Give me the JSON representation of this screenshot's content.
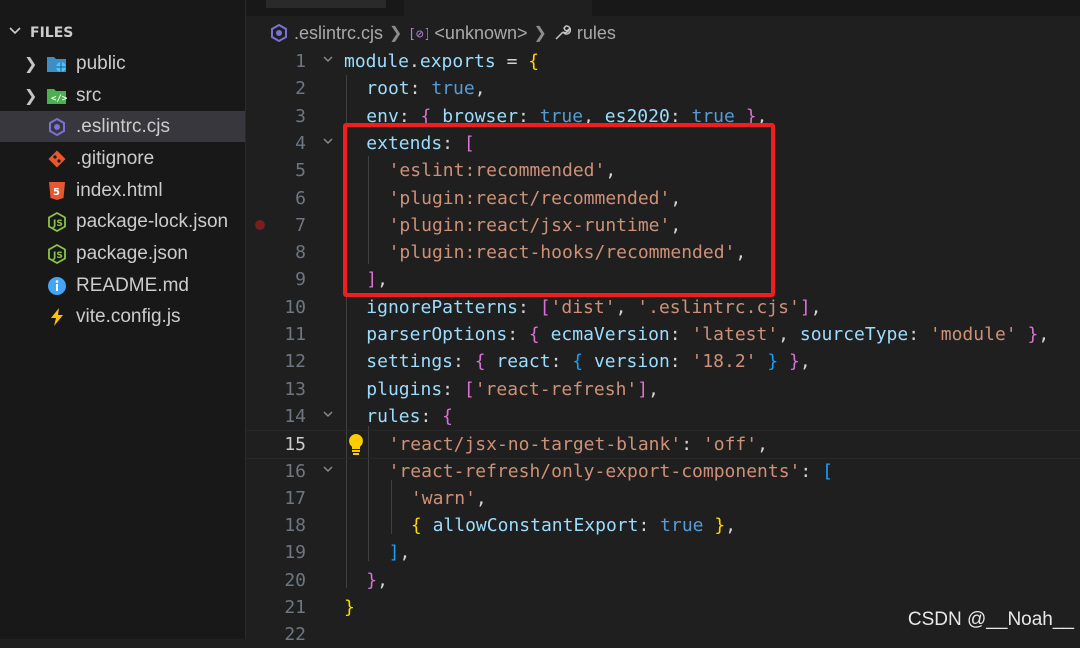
{
  "sidebar": {
    "header": "FILES",
    "items": [
      {
        "label": "public",
        "type": "folder",
        "icon": "folder-public-icon",
        "color": "#4fc1ff"
      },
      {
        "label": "src",
        "type": "folder",
        "icon": "folder-src-icon",
        "color": "#4caf50"
      },
      {
        "label": ".eslintrc.cjs",
        "type": "file",
        "icon": "eslint-icon",
        "color": "#7c6fd6",
        "selected": true
      },
      {
        "label": ".gitignore",
        "type": "file",
        "icon": "git-icon",
        "color": "#e8572f"
      },
      {
        "label": "index.html",
        "type": "file",
        "icon": "html-icon",
        "color": "#e8572f"
      },
      {
        "label": "package-lock.json",
        "type": "file",
        "icon": "nodejs-icon",
        "color": "#8bc34a"
      },
      {
        "label": "package.json",
        "type": "file",
        "icon": "nodejs-icon",
        "color": "#8bc34a"
      },
      {
        "label": "README.md",
        "type": "file",
        "icon": "info-icon",
        "color": "#42a5f5"
      },
      {
        "label": "vite.config.js",
        "type": "file",
        "icon": "vite-icon",
        "color": "#ffc107"
      }
    ]
  },
  "breadcrumb": {
    "file": ".eslintrc.cjs",
    "symbol1": "<unknown>",
    "symbol2": "rules"
  },
  "editor": {
    "active_line": 15,
    "lines": [
      {
        "n": "1",
        "fold": true,
        "tokens": [
          [
            "k",
            "module"
          ],
          [
            "p",
            "."
          ],
          [
            "k",
            "exports"
          ],
          [
            "p",
            " = "
          ],
          [
            "b1",
            "{"
          ]
        ]
      },
      {
        "n": "2",
        "tokens": [
          [
            "k",
            "root"
          ],
          [
            "p",
            ": "
          ],
          [
            "v",
            "true"
          ],
          [
            "p",
            ","
          ]
        ]
      },
      {
        "n": "3",
        "tokens": [
          [
            "k",
            "env"
          ],
          [
            "p",
            ": "
          ],
          [
            "b2",
            "{"
          ],
          [
            "p",
            " "
          ],
          [
            "k",
            "browser"
          ],
          [
            "p",
            ": "
          ],
          [
            "v",
            "true"
          ],
          [
            "p",
            ", "
          ],
          [
            "k",
            "es2020"
          ],
          [
            "p",
            ": "
          ],
          [
            "v",
            "true"
          ],
          [
            "p",
            " "
          ],
          [
            "b2",
            "}"
          ],
          [
            "p",
            ","
          ]
        ]
      },
      {
        "n": "4",
        "fold": true,
        "tokens": [
          [
            "k",
            "extends"
          ],
          [
            "p",
            ": "
          ],
          [
            "b2",
            "["
          ]
        ]
      },
      {
        "n": "5",
        "tokens": [
          [
            "s",
            "'eslint:recommended'"
          ],
          [
            "p",
            ","
          ]
        ]
      },
      {
        "n": "6",
        "tokens": [
          [
            "s",
            "'plugin:react/recommended'"
          ],
          [
            "p",
            ","
          ]
        ]
      },
      {
        "n": "7",
        "tokens": [
          [
            "s",
            "'plugin:react/jsx-runtime'"
          ],
          [
            "p",
            ","
          ]
        ]
      },
      {
        "n": "8",
        "tokens": [
          [
            "s",
            "'plugin:react-hooks/recommended'"
          ],
          [
            "p",
            ","
          ]
        ]
      },
      {
        "n": "9",
        "tokens": [
          [
            "b2",
            "]"
          ],
          [
            "p",
            ","
          ]
        ]
      },
      {
        "n": "10",
        "tokens": [
          [
            "k",
            "ignorePatterns"
          ],
          [
            "p",
            ": "
          ],
          [
            "b2",
            "["
          ],
          [
            "s",
            "'dist'"
          ],
          [
            "p",
            ", "
          ],
          [
            "s",
            "'.eslintrc.cjs'"
          ],
          [
            "b2",
            "]"
          ],
          [
            "p",
            ","
          ]
        ]
      },
      {
        "n": "11",
        "tokens": [
          [
            "k",
            "parserOptions"
          ],
          [
            "p",
            ": "
          ],
          [
            "b2",
            "{"
          ],
          [
            "p",
            " "
          ],
          [
            "k",
            "ecmaVersion"
          ],
          [
            "p",
            ": "
          ],
          [
            "s",
            "'latest'"
          ],
          [
            "p",
            ", "
          ],
          [
            "k",
            "sourceType"
          ],
          [
            "p",
            ": "
          ],
          [
            "s",
            "'module'"
          ],
          [
            "p",
            " "
          ],
          [
            "b2",
            "}"
          ],
          [
            "p",
            ","
          ]
        ]
      },
      {
        "n": "12",
        "tokens": [
          [
            "k",
            "settings"
          ],
          [
            "p",
            ": "
          ],
          [
            "b2",
            "{"
          ],
          [
            "p",
            " "
          ],
          [
            "k",
            "react"
          ],
          [
            "p",
            ": "
          ],
          [
            "b3",
            "{"
          ],
          [
            "p",
            " "
          ],
          [
            "k",
            "version"
          ],
          [
            "p",
            ": "
          ],
          [
            "s",
            "'18.2'"
          ],
          [
            "p",
            " "
          ],
          [
            "b3",
            "}"
          ],
          [
            "p",
            " "
          ],
          [
            "b2",
            "}"
          ],
          [
            "p",
            ","
          ]
        ]
      },
      {
        "n": "13",
        "tokens": [
          [
            "k",
            "plugins"
          ],
          [
            "p",
            ": "
          ],
          [
            "b2",
            "["
          ],
          [
            "s",
            "'react-refresh'"
          ],
          [
            "b2",
            "]"
          ],
          [
            "p",
            ","
          ]
        ]
      },
      {
        "n": "14",
        "fold": true,
        "tokens": [
          [
            "k",
            "rules"
          ],
          [
            "p",
            ": "
          ],
          [
            "b2",
            "{"
          ]
        ]
      },
      {
        "n": "15",
        "tokens": [
          [
            "s",
            "'react/jsx-no-target-blank'"
          ],
          [
            "p",
            ": "
          ],
          [
            "s",
            "'off'"
          ],
          [
            "p",
            ","
          ]
        ]
      },
      {
        "n": "16",
        "fold": true,
        "tokens": [
          [
            "s",
            "'react-refresh/only-export-components'"
          ],
          [
            "p",
            ": "
          ],
          [
            "b3",
            "["
          ]
        ]
      },
      {
        "n": "17",
        "tokens": [
          [
            "s",
            "'warn'"
          ],
          [
            "p",
            ","
          ]
        ]
      },
      {
        "n": "18",
        "tokens": [
          [
            "b1",
            "{"
          ],
          [
            "p",
            " "
          ],
          [
            "k",
            "allowConstantExport"
          ],
          [
            "p",
            ": "
          ],
          [
            "v",
            "true"
          ],
          [
            "p",
            " "
          ],
          [
            "b1",
            "}"
          ],
          [
            "p",
            ","
          ]
        ]
      },
      {
        "n": "19",
        "tokens": [
          [
            "b3",
            "]"
          ],
          [
            "p",
            ","
          ]
        ]
      },
      {
        "n": "20",
        "tokens": [
          [
            "b2",
            "}"
          ],
          [
            "p",
            ","
          ]
        ]
      },
      {
        "n": "21",
        "tokens": [
          [
            "b1",
            "}"
          ]
        ]
      },
      {
        "n": "22",
        "tokens": []
      }
    ]
  },
  "watermark": "CSDN @__Noah__"
}
